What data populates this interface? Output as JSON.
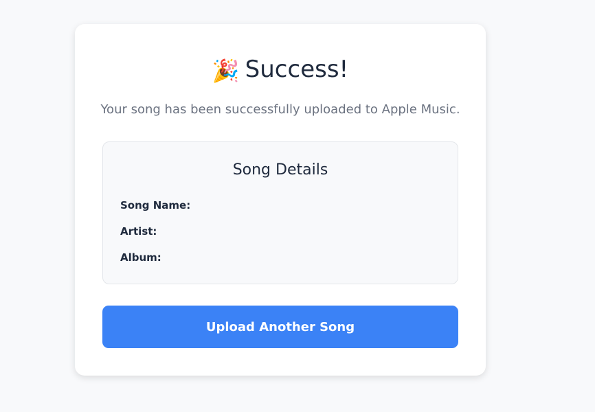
{
  "header": {
    "icon": "party-popper-icon",
    "emoji": "🎉",
    "title": "Success!"
  },
  "subtitle": "Your song has been successfully uploaded to Apple Music.",
  "details": {
    "heading": "Song Details",
    "fields": [
      {
        "label": "Song Name:",
        "value": ""
      },
      {
        "label": "Artist:",
        "value": ""
      },
      {
        "label": "Album:",
        "value": ""
      }
    ]
  },
  "button": {
    "label": "Upload Another Song",
    "color": "#3b82f6"
  }
}
